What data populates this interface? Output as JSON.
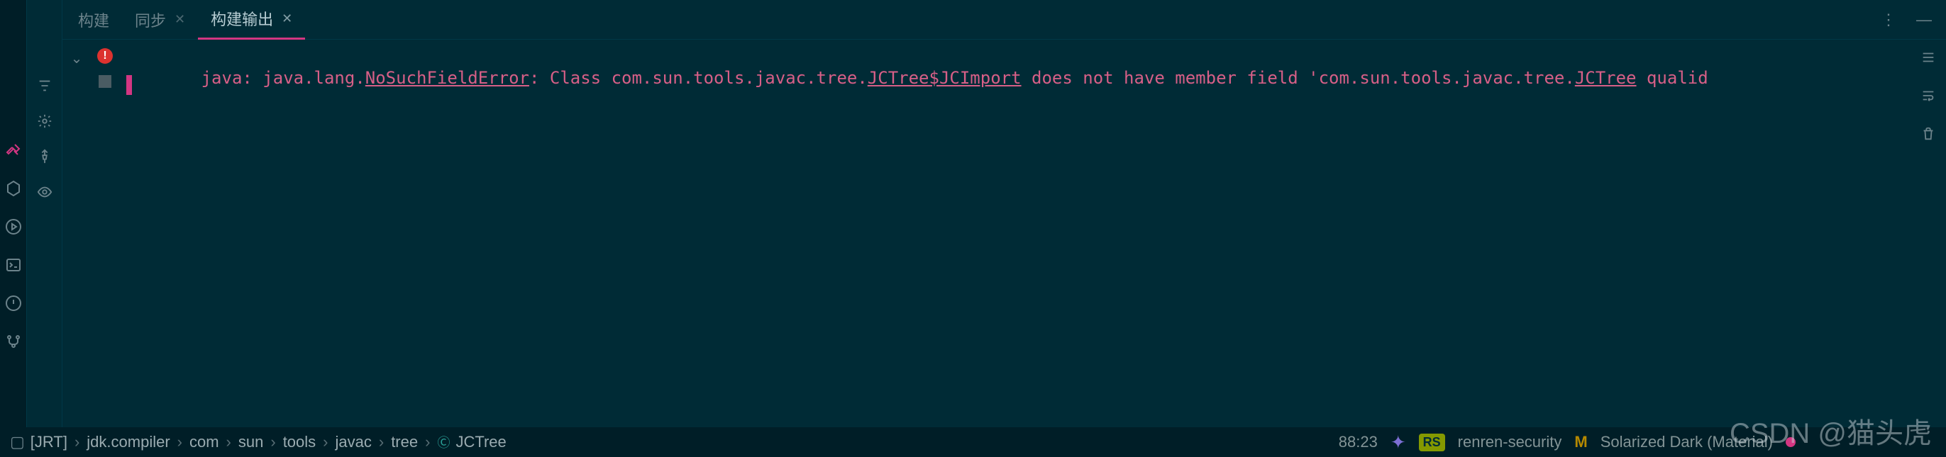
{
  "tabs": [
    {
      "label": "构建",
      "closable": false,
      "active": false
    },
    {
      "label": "同步",
      "closable": true,
      "active": false
    },
    {
      "label": "构建输出",
      "closable": true,
      "active": true
    }
  ],
  "error": {
    "prefix": "java: java.lang.",
    "errClass": "NoSuchFieldError",
    "mid1": ": Class com.sun.tools.javac.tree.",
    "cls1": "JCTree$JCImport",
    "mid2": " does not have member field 'com.sun.tools.javac.tree.",
    "cls2": "JCTree",
    "tail": " qualid"
  },
  "breadcrumb": {
    "module_icon": "□",
    "module": "[JRT]",
    "parts": [
      "jdk.compiler",
      "com",
      "sun",
      "tools",
      "javac",
      "tree"
    ],
    "class_label": "JCTree"
  },
  "status": {
    "lineCol": "88:23",
    "project": "renren-security",
    "theme_prefix": "M",
    "theme": "Solarized Dark (Material)",
    "rs": "RS"
  },
  "watermark": "CSDN @猫头虎"
}
